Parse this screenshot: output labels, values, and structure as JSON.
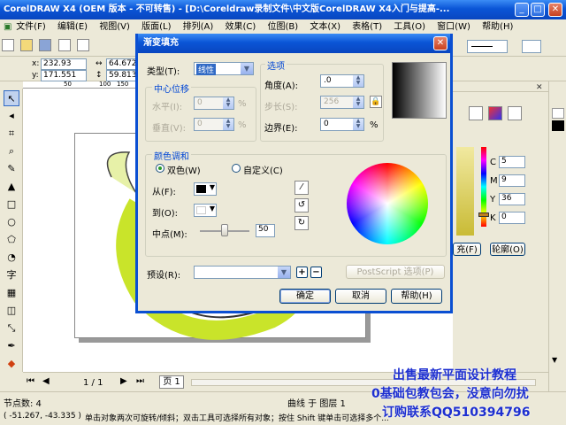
{
  "app": {
    "title": "CorelDRAW X4 (OEM 版本 - 不可转售) - [D:\\Coreldraw录制文件\\中文版CorelDRAW X4入门与提高-..."
  },
  "menu": [
    "文件(F)",
    "编辑(E)",
    "视图(V)",
    "版面(L)",
    "排列(A)",
    "效果(C)",
    "位图(B)",
    "文本(X)",
    "表格(T)",
    "工具(O)",
    "窗口(W)",
    "帮助(H)"
  ],
  "propbar": {
    "x": "232.93 mm",
    "y": "171.551 mm",
    "w": "64.672",
    "h": "59.813"
  },
  "ruler_top": [
    "50",
    "100",
    "150"
  ],
  "dialog": {
    "title": "渐变填充",
    "type_label": "类型(T):",
    "type_value": "线性",
    "center_group": "中心位移",
    "horiz_label": "水平(I):",
    "horiz_value": "0",
    "vert_label": "垂直(V):",
    "vert_value": "0",
    "unit": "%",
    "options_group": "选项",
    "angle_label": "角度(A):",
    "angle_value": ".0",
    "steps_label": "步长(S):",
    "steps_value": "256",
    "edge_label": "边界(E):",
    "edge_value": "0",
    "color_group": "颜色调和",
    "two_color": "双色(W)",
    "custom": "自定义(C)",
    "from_label": "从(F):",
    "to_label": "到(O):",
    "mid_label": "中点(M):",
    "mid_value": "50",
    "preset_label": "预设(R):",
    "postscript": "PostScript 选项(P)",
    "ok": "确定",
    "cancel": "取消",
    "help": "帮助(H)",
    "from_color": "#000000",
    "to_color": "#ffffff"
  },
  "right_panel": {
    "c_label": "C",
    "c_value": "5",
    "m_label": "M",
    "m_value": "9",
    "y_label": "Y",
    "y_value": "36",
    "k_label": "K",
    "k_value": "0",
    "fill_btn": "充(F)",
    "outline_btn": "轮廓(O)"
  },
  "pager": {
    "current": "1 / 1",
    "page_tab": "页 1"
  },
  "status": {
    "nodes": "节点数: 4",
    "curve_layer": "曲线 于 图层 1",
    "coords": "( -51.267, -43.335 )",
    "hint": "单击对象两次可旋转/倾斜；双击工具可选择所有对象；按住 Shift 键单击可选择多个..."
  },
  "promo": {
    "line1": "出售最新平面设计教程",
    "line2": "0基础包教包会，没意向勿扰",
    "line3": "订购联系QQ510394796"
  }
}
